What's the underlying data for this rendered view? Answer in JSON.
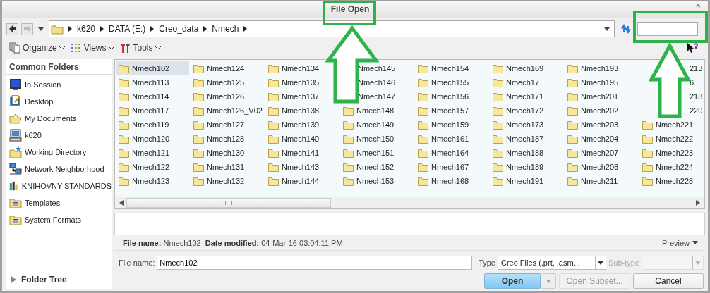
{
  "window": {
    "title": "File Open",
    "close": "×"
  },
  "address": {
    "path": [
      "k620",
      "DATA (E:)",
      "Creo_data",
      "Nmech"
    ]
  },
  "toolbar": [
    {
      "label": "Organize"
    },
    {
      "label": "Views"
    },
    {
      "label": "Tools"
    }
  ],
  "sidebar": {
    "title": "Common Folders",
    "items": [
      {
        "label": "In Session"
      },
      {
        "label": "Desktop"
      },
      {
        "label": "My Documents"
      },
      {
        "label": "k620"
      },
      {
        "label": "Working Directory"
      },
      {
        "label": "Network Neighborhood"
      },
      {
        "label": "KNIHOVNY-STANDARDS"
      },
      {
        "label": "Templates"
      },
      {
        "label": "System Formats"
      }
    ],
    "footer": "Folder Tree"
  },
  "files": [
    {
      "name": "Nmech102",
      "selected": true,
      "kind": "folder"
    },
    {
      "name": "Nmech113",
      "selected": false,
      "kind": "folder"
    },
    {
      "name": "Nmech114",
      "selected": false,
      "kind": "folder"
    },
    {
      "name": "Nmech117",
      "selected": false,
      "kind": "folder"
    },
    {
      "name": "Nmech119",
      "selected": false,
      "kind": "folder"
    },
    {
      "name": "Nmech120",
      "selected": false,
      "kind": "folder"
    },
    {
      "name": "Nmech121",
      "selected": false,
      "kind": "folder"
    },
    {
      "name": "Nmech122",
      "selected": false,
      "kind": "folder"
    },
    {
      "name": "Nmech123",
      "selected": false,
      "kind": "folder"
    },
    {
      "name": "Nmech124",
      "selected": false,
      "kind": "folder"
    },
    {
      "name": "Nmech125",
      "selected": false,
      "kind": "folder"
    },
    {
      "name": "Nmech126",
      "selected": false,
      "kind": "folder"
    },
    {
      "name": "Nmech126_V02",
      "selected": false,
      "kind": "folder"
    },
    {
      "name": "Nmech127",
      "selected": false,
      "kind": "folder"
    },
    {
      "name": "Nmech128",
      "selected": false,
      "kind": "folder"
    },
    {
      "name": "Nmech130",
      "selected": false,
      "kind": "folder"
    },
    {
      "name": "Nmech131",
      "selected": false,
      "kind": "folder"
    },
    {
      "name": "Nmech132",
      "selected": false,
      "kind": "folder"
    },
    {
      "name": "Nmech134",
      "selected": false,
      "kind": "folder"
    },
    {
      "name": "Nmech135",
      "selected": false,
      "kind": "folder"
    },
    {
      "name": "Nmech137",
      "selected": false,
      "kind": "folder"
    },
    {
      "name": "Nmech138",
      "selected": false,
      "kind": "folder"
    },
    {
      "name": "Nmech139",
      "selected": false,
      "kind": "folder"
    },
    {
      "name": "Nmech140",
      "selected": false,
      "kind": "folder"
    },
    {
      "name": "Nmech141",
      "selected": false,
      "kind": "folder"
    },
    {
      "name": "Nmech143",
      "selected": false,
      "kind": "folder"
    },
    {
      "name": "Nmech144",
      "selected": false,
      "kind": "folder"
    },
    {
      "name": "Nmech145",
      "selected": false,
      "kind": "covered"
    },
    {
      "name": "Nmech146",
      "selected": false,
      "kind": "covered"
    },
    {
      "name": "Nmech147",
      "selected": false,
      "kind": "covered"
    },
    {
      "name": "Nmech148",
      "selected": false,
      "kind": "folder"
    },
    {
      "name": "Nmech149",
      "selected": false,
      "kind": "folder"
    },
    {
      "name": "Nmech150",
      "selected": false,
      "kind": "folder"
    },
    {
      "name": "Nmech151",
      "selected": false,
      "kind": "folder"
    },
    {
      "name": "Nmech152",
      "selected": false,
      "kind": "folder"
    },
    {
      "name": "Nmech153",
      "selected": false,
      "kind": "folder"
    },
    {
      "name": "Nmech154",
      "selected": false,
      "kind": "folder"
    },
    {
      "name": "Nmech155",
      "selected": false,
      "kind": "folder"
    },
    {
      "name": "Nmech156",
      "selected": false,
      "kind": "folder"
    },
    {
      "name": "Nmech157",
      "selected": false,
      "kind": "folder"
    },
    {
      "name": "Nmech159",
      "selected": false,
      "kind": "folder"
    },
    {
      "name": "Nmech161",
      "selected": false,
      "kind": "folder"
    },
    {
      "name": "Nmech164",
      "selected": false,
      "kind": "folder"
    },
    {
      "name": "Nmech167",
      "selected": false,
      "kind": "folder"
    },
    {
      "name": "Nmech168",
      "selected": false,
      "kind": "folder"
    },
    {
      "name": "Nmech169",
      "selected": false,
      "kind": "folder"
    },
    {
      "name": "Nmech17",
      "selected": false,
      "kind": "folder"
    },
    {
      "name": "Nmech171",
      "selected": false,
      "kind": "folder"
    },
    {
      "name": "Nmech172",
      "selected": false,
      "kind": "folder"
    },
    {
      "name": "Nmech173",
      "selected": false,
      "kind": "folder"
    },
    {
      "name": "Nmech187",
      "selected": false,
      "kind": "folder"
    },
    {
      "name": "Nmech188",
      "selected": false,
      "kind": "folder"
    },
    {
      "name": "Nmech189",
      "selected": false,
      "kind": "folder"
    },
    {
      "name": "Nmech191",
      "selected": false,
      "kind": "folder"
    },
    {
      "name": "Nmech193",
      "selected": false,
      "kind": "folder"
    },
    {
      "name": "Nmech195",
      "selected": false,
      "kind": "folder"
    },
    {
      "name": "Nmech201",
      "selected": false,
      "kind": "folder"
    },
    {
      "name": "Nmech202",
      "selected": false,
      "kind": "folder"
    },
    {
      "name": "Nmech203",
      "selected": false,
      "kind": "folder"
    },
    {
      "name": "Nmech204",
      "selected": false,
      "kind": "folder"
    },
    {
      "name": "Nmech207",
      "selected": false,
      "kind": "folder"
    },
    {
      "name": "Nmech208",
      "selected": false,
      "kind": "folder"
    },
    {
      "name": "Nmech211",
      "selected": false,
      "kind": "folder"
    },
    {
      "name": "213",
      "selected": false,
      "kind": "cut"
    },
    {
      "name": "6",
      "selected": false,
      "kind": "cut"
    },
    {
      "name": "218",
      "selected": false,
      "kind": "cut"
    },
    {
      "name": "220",
      "selected": false,
      "kind": "cut"
    },
    {
      "name": "Nmech221",
      "selected": false,
      "kind": "folder"
    },
    {
      "name": "Nmech222",
      "selected": false,
      "kind": "folder"
    },
    {
      "name": "Nmech223",
      "selected": false,
      "kind": "folder"
    },
    {
      "name": "Nmech224",
      "selected": false,
      "kind": "folder"
    },
    {
      "name": "Nmech228",
      "selected": false,
      "kind": "folder"
    }
  ],
  "info": {
    "name_label": "File name:",
    "name": "Nmech102",
    "date_label": "Date modified:",
    "date": "04-Mar-16 03:04:11 PM"
  },
  "preview": "Preview",
  "form": {
    "name_label": "File name:",
    "name_value": "Nmech102",
    "type_label": "Type",
    "type_value": "Creo Files (.prt, .asm, .",
    "subtype_label": "Sub-type",
    "subtype_disabled": true
  },
  "buttons": [
    {
      "label": "Open",
      "kind": "primary"
    },
    {
      "label": "Open Subset...",
      "kind": "disabled"
    },
    {
      "label": "Cancel",
      "kind": "normal"
    }
  ]
}
